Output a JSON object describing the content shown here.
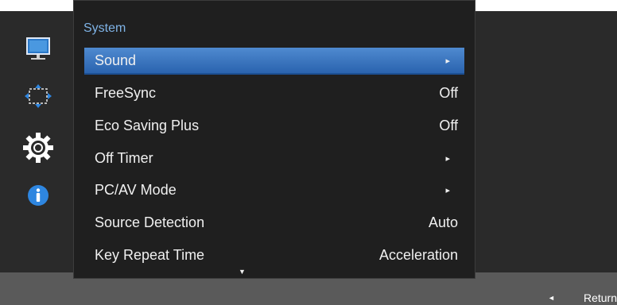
{
  "menu": {
    "title": "System",
    "items": [
      {
        "label": "Sound",
        "value": "",
        "arrow": "▸",
        "selected": true
      },
      {
        "label": "FreeSync",
        "value": "Off",
        "arrow": "",
        "selected": false
      },
      {
        "label": "Eco Saving Plus",
        "value": "Off",
        "arrow": "",
        "selected": false
      },
      {
        "label": "Off Timer",
        "value": "",
        "arrow": "▸",
        "selected": false
      },
      {
        "label": "PC/AV Mode",
        "value": "",
        "arrow": "▸",
        "selected": false
      },
      {
        "label": "Source Detection",
        "value": "Auto",
        "arrow": "",
        "selected": false
      },
      {
        "label": "Key Repeat Time",
        "value": "Acceleration",
        "arrow": "",
        "selected": false
      }
    ],
    "scroll_indicator": "▼"
  },
  "sidebar": {
    "icons": [
      "picture-icon",
      "onscreen-display-icon",
      "system-gear-icon",
      "information-icon"
    ]
  },
  "footer": {
    "return_arrow": "◄",
    "return_label": "Return"
  },
  "colors": {
    "accent": "#3a76c2",
    "title_text": "#7fb3e6",
    "panel_bg": "#1f1f1f",
    "osd_bg": "#2a2a2a",
    "bottom_bar": "#5a5a5a"
  }
}
